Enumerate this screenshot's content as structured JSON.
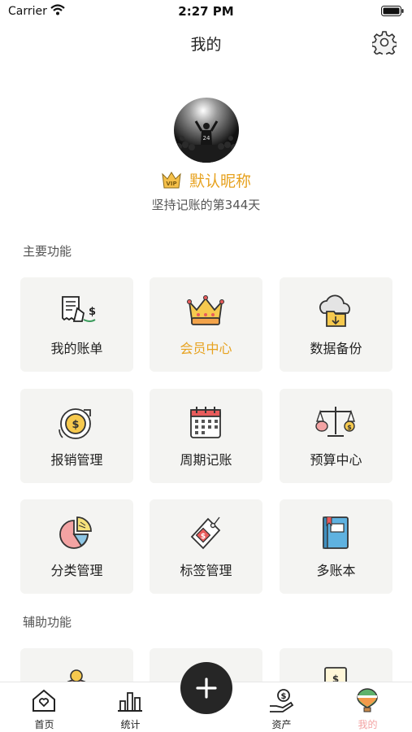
{
  "status": {
    "carrier": "Carrier",
    "time": "2:27 PM"
  },
  "nav": {
    "title": "我的",
    "settings_icon": "gear-icon"
  },
  "profile": {
    "nickname": "默认昵称",
    "days_text": "坚持记账的第344天",
    "badge_icon": "vip-crown-icon"
  },
  "sections": {
    "main_title": "主要功能",
    "aux_title": "辅助功能"
  },
  "main_features": [
    {
      "label": "我的账单",
      "icon": "bill-icon"
    },
    {
      "label": "会员中心",
      "icon": "crown-icon",
      "highlight": "#e7a21f"
    },
    {
      "label": "数据备份",
      "icon": "cloud-folder-icon"
    },
    {
      "label": "报销管理",
      "icon": "coin-refund-icon"
    },
    {
      "label": "周期记账",
      "icon": "calendar-icon"
    },
    {
      "label": "预算中心",
      "icon": "balance-scale-icon"
    },
    {
      "label": "分类管理",
      "icon": "pie-chart-icon"
    },
    {
      "label": "标签管理",
      "icon": "price-tag-icon"
    },
    {
      "label": "多账本",
      "icon": "ledger-book-icon"
    }
  ],
  "tabbar": [
    {
      "label": "首页",
      "icon": "home-icon"
    },
    {
      "label": "统计",
      "icon": "bar-chart-icon"
    },
    {
      "label": "资产",
      "icon": "hand-coin-icon"
    },
    {
      "label": "我的",
      "icon": "balloon-icon",
      "active": true
    }
  ],
  "fab": {
    "icon": "plus-icon"
  },
  "colors": {
    "accent": "#e7a21f",
    "active_tab": "#f3a3a3",
    "tile_bg": "#f4f4f2",
    "fab_bg": "#262626"
  }
}
